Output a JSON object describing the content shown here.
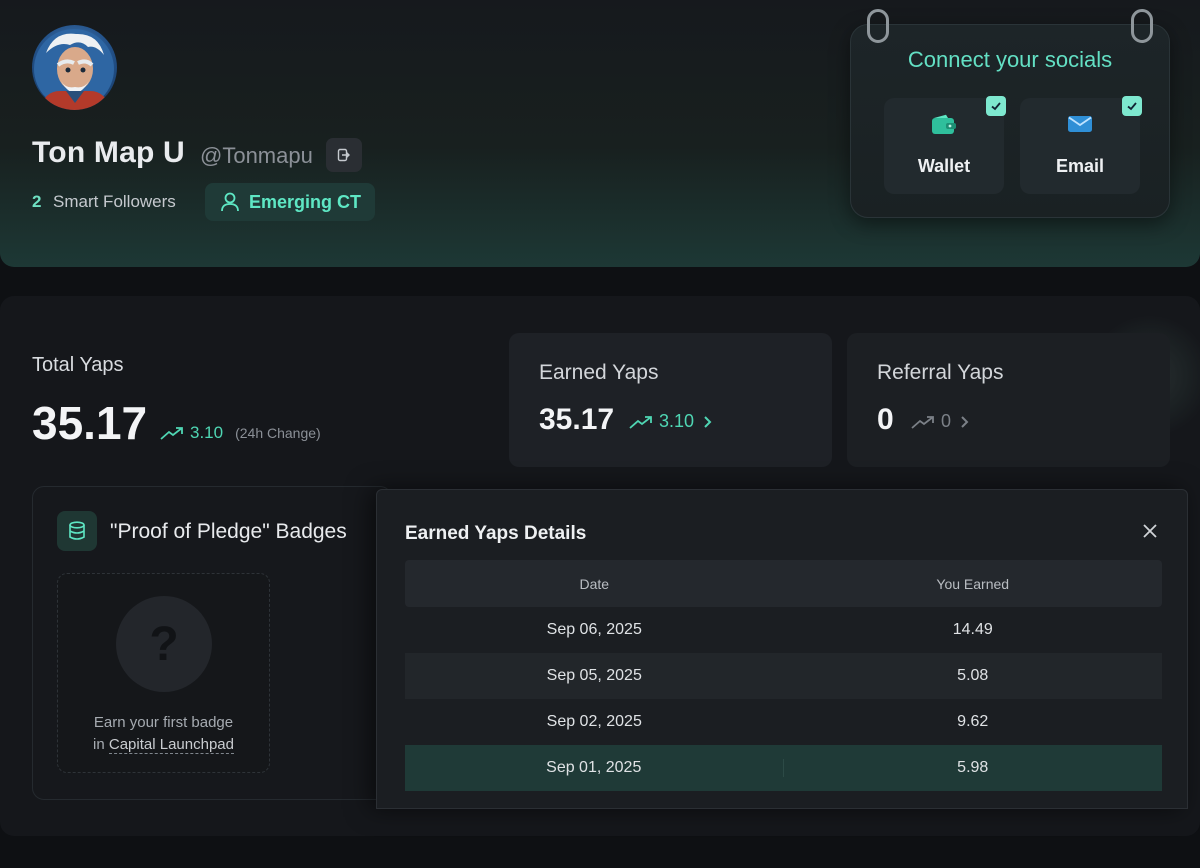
{
  "profile": {
    "name": "Ton Map U",
    "handle": "@Tonmapu",
    "followers_count": "2",
    "followers_label": "Smart Followers",
    "tier": "Emerging CT"
  },
  "socials": {
    "title": "Connect your socials",
    "items": [
      {
        "label": "Wallet",
        "icon": "wallet-icon",
        "connected": true
      },
      {
        "label": "Email",
        "icon": "email-icon",
        "connected": true
      }
    ]
  },
  "stats": {
    "total": {
      "label": "Total Yaps",
      "value": "35.17",
      "change": "3.10",
      "change_note": "(24h Change)"
    },
    "earned": {
      "label": "Earned Yaps",
      "value": "35.17",
      "change": "3.10"
    },
    "referral": {
      "label": "Referral Yaps",
      "value": "0",
      "change": "0"
    }
  },
  "badges": {
    "title": "\"Proof of Pledge\" Badges",
    "hint_line1": "Earn your first badge",
    "hint_prefix": "in",
    "hint_link": "Capital Launchpad",
    "placeholder": "?"
  },
  "modal": {
    "title": "Earned Yaps Details",
    "columns": [
      "Date",
      "You Earned"
    ],
    "rows": [
      {
        "date": "Sep 06, 2025",
        "earned": "14.49"
      },
      {
        "date": "Sep 05, 2025",
        "earned": "5.08"
      },
      {
        "date": "Sep 02, 2025",
        "earned": "9.62"
      },
      {
        "date": "Sep 01, 2025",
        "earned": "5.98"
      }
    ]
  },
  "colors": {
    "accent": "#5ee7c4",
    "positive": "#4fd6b3",
    "panel": "#15171b",
    "highlight_row": "#1f3a37"
  }
}
